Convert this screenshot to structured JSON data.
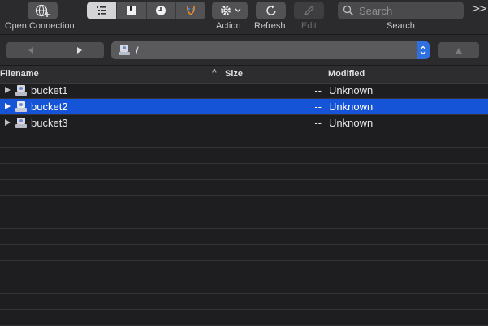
{
  "toolbar": {
    "open_connection_label": "Open Connection",
    "action_label": "Action",
    "refresh_label": "Refresh",
    "edit_label": "Edit",
    "search_label": "Search",
    "search_placeholder": "Search",
    "view_modes": [
      "browser-list",
      "bookmarks",
      "history",
      "bonjour"
    ],
    "active_view": "browser-list"
  },
  "pathbar": {
    "path": "/"
  },
  "table": {
    "headers": {
      "filename": "Filename",
      "size": "Size",
      "modified": "Modified"
    },
    "rows": [
      {
        "name": "bucket1",
        "size": "--",
        "modified": "Unknown",
        "selected": false
      },
      {
        "name": "bucket2",
        "size": "--",
        "modified": "Unknown",
        "selected": true
      },
      {
        "name": "bucket3",
        "size": "--",
        "modified": "Unknown",
        "selected": false
      }
    ]
  },
  "colors": {
    "selection": "#1554d6",
    "background": "#1e1e20",
    "toolbar": "#2b2b2d"
  }
}
